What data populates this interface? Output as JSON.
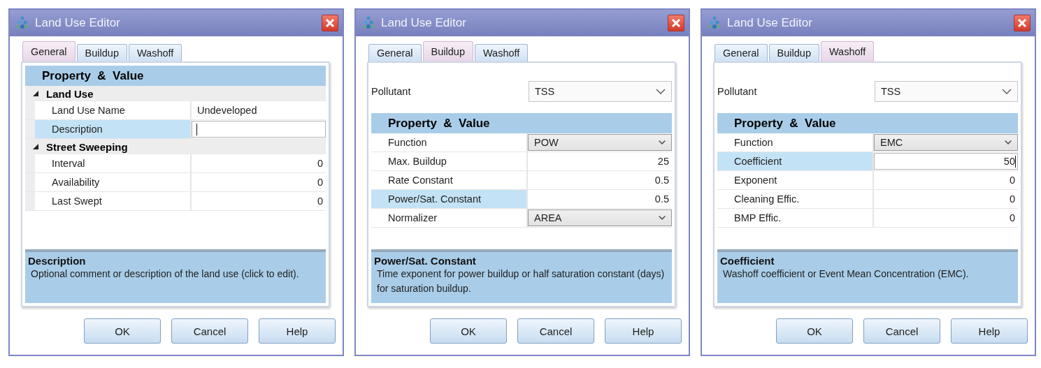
{
  "dialogs": [
    {
      "title": "Land Use Editor",
      "tabs": [
        {
          "label": "General",
          "selected": true
        },
        {
          "label": "Buildup",
          "selected": false
        },
        {
          "label": "Washoff",
          "selected": false
        }
      ],
      "grid": {
        "header": "Property  &  Value",
        "rows": [
          {
            "kind": "group",
            "label": "Land Use",
            "expanded": true,
            "children": [
              {
                "kind": "text",
                "label": "Land Use Name",
                "value": "Undeveloped",
                "selected": false,
                "editing": false
              },
              {
                "kind": "text",
                "label": "Description",
                "selected": true,
                "editing": true
              }
            ]
          },
          {
            "kind": "group",
            "label": "Street Sweeping",
            "expanded": true,
            "children": [
              {
                "kind": "number",
                "label": "Interval",
                "value": "0",
                "selected": false,
                "editing": false
              },
              {
                "kind": "number",
                "label": "Availability",
                "value": "0",
                "selected": false,
                "editing": false
              },
              {
                "kind": "number",
                "label": "Last Swept",
                "value": "0",
                "selected": false,
                "editing": false
              }
            ]
          }
        ]
      },
      "description": {
        "title": "Description",
        "text": "Optional comment or description of the land use (click to edit)."
      },
      "buttons": [
        "OK",
        "Cancel",
        "Help"
      ]
    },
    {
      "title": "Land Use Editor",
      "tabs": [
        {
          "label": "General",
          "selected": false
        },
        {
          "label": "Buildup",
          "selected": true
        },
        {
          "label": "Washoff",
          "selected": false
        }
      ],
      "pollutant": {
        "label": "Pollutant",
        "value": "TSS"
      },
      "grid": {
        "header": "Property  &  Value",
        "rows": [
          {
            "kind": "dropdown",
            "label": "Function",
            "value": "POW",
            "selected": false,
            "editing": false
          },
          {
            "kind": "number",
            "label": "Max. Buildup",
            "value": "25",
            "selected": false,
            "editing": false
          },
          {
            "kind": "number",
            "label": "Rate Constant",
            "value": "0.5",
            "selected": false,
            "editing": false
          },
          {
            "kind": "number",
            "label": "Power/Sat. Constant",
            "value": "0.5",
            "selected": true,
            "editing": false
          },
          {
            "kind": "dropdown",
            "label": "Normalizer",
            "value": "AREA",
            "selected": false,
            "editing": false
          }
        ]
      },
      "description": {
        "title": "Power/Sat. Constant",
        "text": "Time exponent for power buildup or half saturation constant (days) for saturation buildup."
      },
      "buttons": [
        "OK",
        "Cancel",
        "Help"
      ]
    },
    {
      "title": "Land Use Editor",
      "tabs": [
        {
          "label": "General",
          "selected": false
        },
        {
          "label": "Buildup",
          "selected": false
        },
        {
          "label": "Washoff",
          "selected": true
        }
      ],
      "pollutant": {
        "label": "Pollutant",
        "value": "TSS"
      },
      "grid": {
        "header": "Property  &  Value",
        "rows": [
          {
            "kind": "dropdown",
            "label": "Function",
            "value": "EMC",
            "selected": false,
            "editing": false
          },
          {
            "kind": "number",
            "label": "Coefficient",
            "value": "50",
            "selected": true,
            "editing": true
          },
          {
            "kind": "number",
            "label": "Exponent",
            "value": "0",
            "selected": false,
            "editing": false
          },
          {
            "kind": "number",
            "label": "Cleaning Effic.",
            "value": "0",
            "selected": false,
            "editing": false
          },
          {
            "kind": "number",
            "label": "BMP Effic.",
            "value": "0",
            "selected": false,
            "editing": false
          }
        ]
      },
      "description": {
        "title": "Coefficient",
        "text": "Washoff coefficient or Event Mean Concentration (EMC)."
      },
      "buttons": [
        "OK",
        "Cancel",
        "Help"
      ]
    }
  ]
}
